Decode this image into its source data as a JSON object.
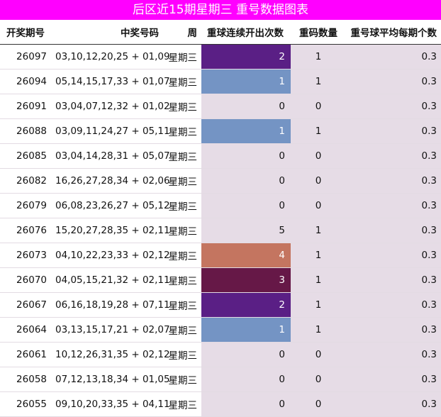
{
  "title": "后区近15期星期三  重号数据图表",
  "headers": [
    "开奖期号",
    "中奖号码",
    "周",
    "重球连续开出次数",
    "重码数量",
    "重号球平均每期个数"
  ],
  "colors": {
    "title_bg": "#ff00ff",
    "streak_0": "#e6dce6",
    "streak_1": "#7494c4",
    "streak_2": "#5a1f85",
    "streak_3": "#661847",
    "streak_4": "#c47560",
    "streak_5": "#e6dce6"
  },
  "rows": [
    {
      "issue": "26097",
      "numbers": "03,10,12,20,25 + 01,09",
      "weekday": "星期三",
      "streak": "2",
      "repeat_count": "1",
      "avg": "0.3"
    },
    {
      "issue": "26094",
      "numbers": "05,14,15,17,33 + 01,07",
      "weekday": "星期三",
      "streak": "1",
      "repeat_count": "1",
      "avg": "0.3"
    },
    {
      "issue": "26091",
      "numbers": "03,04,07,12,32 + 01,02",
      "weekday": "星期三",
      "streak": "0",
      "repeat_count": "0",
      "avg": "0.3"
    },
    {
      "issue": "26088",
      "numbers": "03,09,11,24,27 + 05,11",
      "weekday": "星期三",
      "streak": "1",
      "repeat_count": "1",
      "avg": "0.3"
    },
    {
      "issue": "26085",
      "numbers": "03,04,14,28,31 + 05,07",
      "weekday": "星期三",
      "streak": "0",
      "repeat_count": "0",
      "avg": "0.3"
    },
    {
      "issue": "26082",
      "numbers": "16,26,27,28,34 + 02,06",
      "weekday": "星期三",
      "streak": "0",
      "repeat_count": "0",
      "avg": "0.3"
    },
    {
      "issue": "26079",
      "numbers": "06,08,23,26,27 + 05,12",
      "weekday": "星期三",
      "streak": "0",
      "repeat_count": "0",
      "avg": "0.3"
    },
    {
      "issue": "26076",
      "numbers": "15,20,27,28,35 + 02,11",
      "weekday": "星期三",
      "streak": "5",
      "repeat_count": "1",
      "avg": "0.3"
    },
    {
      "issue": "26073",
      "numbers": "04,10,22,23,33 + 02,12",
      "weekday": "星期三",
      "streak": "4",
      "repeat_count": "1",
      "avg": "0.3"
    },
    {
      "issue": "26070",
      "numbers": "04,05,15,21,32 + 02,11",
      "weekday": "星期三",
      "streak": "3",
      "repeat_count": "1",
      "avg": "0.3"
    },
    {
      "issue": "26067",
      "numbers": "06,16,18,19,28 + 07,11",
      "weekday": "星期三",
      "streak": "2",
      "repeat_count": "1",
      "avg": "0.3"
    },
    {
      "issue": "26064",
      "numbers": "03,13,15,17,21 + 02,07",
      "weekday": "星期三",
      "streak": "1",
      "repeat_count": "1",
      "avg": "0.3"
    },
    {
      "issue": "26061",
      "numbers": "10,12,26,31,35 + 02,12",
      "weekday": "星期三",
      "streak": "0",
      "repeat_count": "0",
      "avg": "0.3"
    },
    {
      "issue": "26058",
      "numbers": "07,12,13,18,34 + 01,05",
      "weekday": "星期三",
      "streak": "0",
      "repeat_count": "0",
      "avg": "0.3"
    },
    {
      "issue": "26055",
      "numbers": "09,10,20,33,35 + 04,11",
      "weekday": "星期三",
      "streak": "0",
      "repeat_count": "0",
      "avg": "0.3"
    }
  ]
}
